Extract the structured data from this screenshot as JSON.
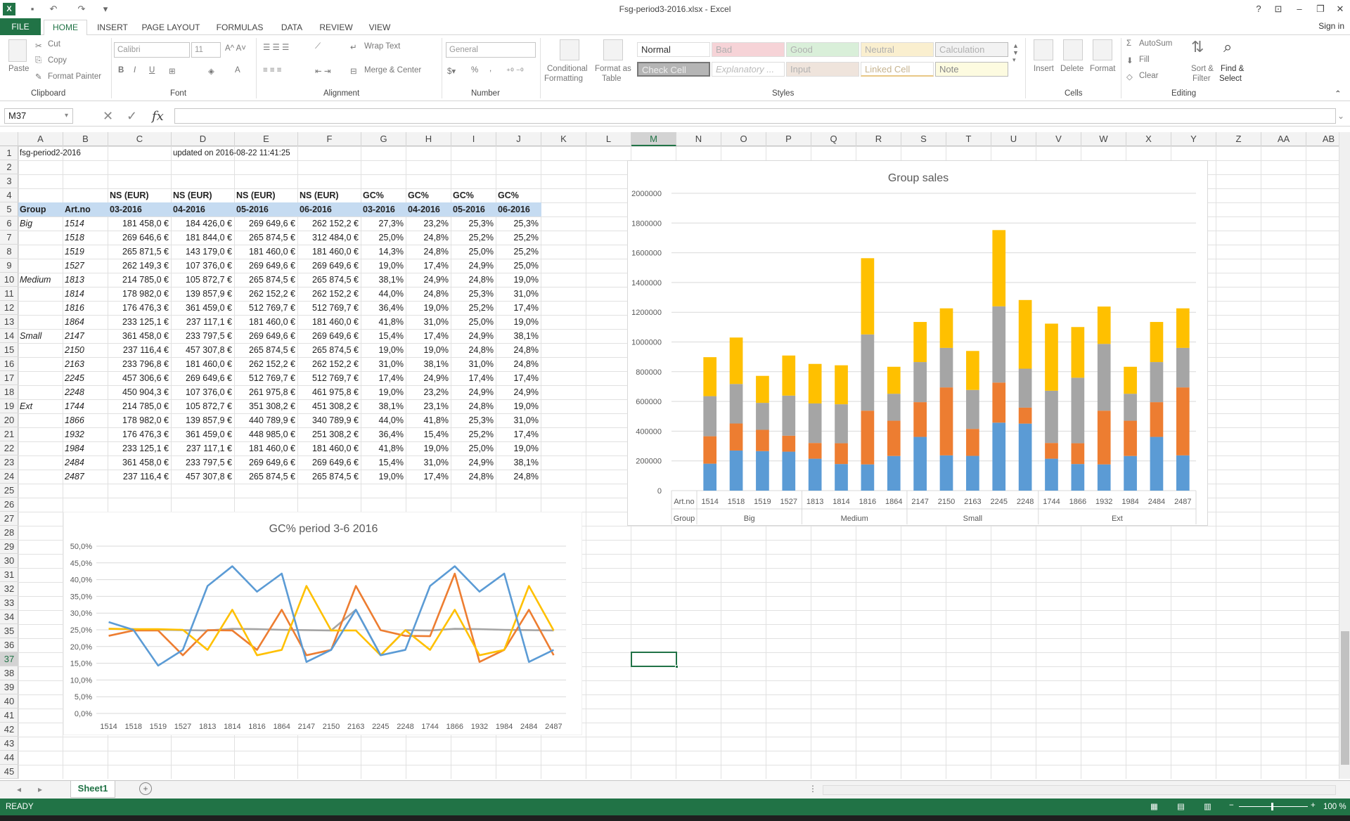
{
  "app": {
    "window_title": "Fsg-period3-2016.xlsx - Excel",
    "sign_in": "Sign in",
    "help": "?"
  },
  "tabs": [
    "FILE",
    "HOME",
    "INSERT",
    "PAGE LAYOUT",
    "FORMULAS",
    "DATA",
    "REVIEW",
    "VIEW"
  ],
  "ribbon": {
    "clipboard": {
      "label": "Clipboard",
      "paste": "Paste",
      "cut": "Cut",
      "copy": "Copy",
      "format_painter": "Format Painter"
    },
    "font": {
      "label": "Font",
      "family": "Calibri",
      "size": "11",
      "bold": "B",
      "italic": "I",
      "underline": "U"
    },
    "alignment": {
      "label": "Alignment",
      "wrap": "Wrap Text",
      "merge": "Merge & Center"
    },
    "number": {
      "label": "Number",
      "format": "General",
      "percent": "%",
      "comma": ","
    },
    "styles": {
      "label": "Styles",
      "conditional": "Conditional",
      "conditional2": "Formatting",
      "format_as": "Format as",
      "format_as2": "Table",
      "items": [
        "Normal",
        "Bad",
        "Good",
        "Neutral",
        "Calculation",
        "Check Cell",
        "Explanatory ...",
        "Input",
        "Linked Cell",
        "Note"
      ]
    },
    "cells": {
      "label": "Cells",
      "insert": "Insert",
      "delete": "Delete",
      "format": "Format"
    },
    "editing": {
      "label": "Editing",
      "autosum": "AutoSum",
      "fill": "Fill",
      "clear": "Clear",
      "sort": "Sort &",
      "sort2": "Filter",
      "find": "Find &",
      "find2": "Select"
    }
  },
  "formula_bar": {
    "name_box": "M37",
    "value": "",
    "fx": "fx"
  },
  "columns": [
    "A",
    "B",
    "C",
    "D",
    "E",
    "F",
    "G",
    "H",
    "I",
    "J",
    "K",
    "L",
    "M",
    "N",
    "O",
    "P",
    "Q",
    "R",
    "S",
    "T",
    "U",
    "V",
    "W",
    "X",
    "Y",
    "Z",
    "AA",
    "AB"
  ],
  "selected_column": "M",
  "selected_row": 37,
  "sheet": {
    "a1": "fsg-period2-2016",
    "d1": "updated on 2016-08-22 11:41:25",
    "row4": [
      "NS (EUR)",
      "NS (EUR)",
      "NS (EUR)",
      "NS (EUR)",
      "GC%",
      "GC%",
      "GC%",
      "GC%"
    ],
    "row5": [
      "Group",
      "Art.no",
      "03-2016",
      "04-2016",
      "05-2016",
      "06-2016",
      "03-2016",
      "04-2016",
      "05-2016",
      "06-2016"
    ],
    "rows": [
      [
        "Big",
        "1514",
        "181 458,0 €",
        "184 426,0 €",
        "269 649,6 €",
        "262 152,2 €",
        "27,3%",
        "23,2%",
        "25,3%",
        "25,3%"
      ],
      [
        "",
        "1518",
        "269 646,6 €",
        "181 844,0 €",
        "265 874,5 €",
        "312 484,0 €",
        "25,0%",
        "24,8%",
        "25,2%",
        "25,2%"
      ],
      [
        "",
        "1519",
        "265 871,5 €",
        "143 179,0 €",
        "181 460,0 €",
        "181 460,0 €",
        "14,3%",
        "24,8%",
        "25,0%",
        "25,2%"
      ],
      [
        "",
        "1527",
        "262 149,3 €",
        "107 376,0 €",
        "269 649,6 €",
        "269 649,6 €",
        "19,0%",
        "17,4%",
        "24,9%",
        "25,0%"
      ],
      [
        "Medium",
        "1813",
        "214 785,0 €",
        "105 872,7 €",
        "265 874,5 €",
        "265 874,5 €",
        "38,1%",
        "24,9%",
        "24,8%",
        "19,0%"
      ],
      [
        "",
        "1814",
        "178 982,0 €",
        "139 857,9 €",
        "262 152,2 €",
        "262 152,2 €",
        "44,0%",
        "24,8%",
        "25,3%",
        "31,0%"
      ],
      [
        "",
        "1816",
        "176 476,3 €",
        "361 459,0 €",
        "512 769,7 €",
        "512 769,7 €",
        "36,4%",
        "19,0%",
        "25,2%",
        "17,4%"
      ],
      [
        "",
        "1864",
        "233 125,1 €",
        "237 117,1 €",
        "181 460,0 €",
        "181 460,0 €",
        "41,8%",
        "31,0%",
        "25,0%",
        "19,0%"
      ],
      [
        "Small",
        "2147",
        "361 458,0 €",
        "233 797,5 €",
        "269 649,6 €",
        "269 649,6 €",
        "15,4%",
        "17,4%",
        "24,9%",
        "38,1%"
      ],
      [
        "",
        "2150",
        "237 116,4 €",
        "457 307,8 €",
        "265 874,5 €",
        "265 874,5 €",
        "19,0%",
        "19,0%",
        "24,8%",
        "24,8%"
      ],
      [
        "",
        "2163",
        "233 796,8 €",
        "181 460,0 €",
        "262 152,2 €",
        "262 152,2 €",
        "31,0%",
        "38,1%",
        "31,0%",
        "24,8%"
      ],
      [
        "",
        "2245",
        "457 306,6 €",
        "269 649,6 €",
        "512 769,7 €",
        "512 769,7 €",
        "17,4%",
        "24,9%",
        "17,4%",
        "17,4%"
      ],
      [
        "",
        "2248",
        "450 904,3 €",
        "107 376,0 €",
        "261 975,8 €",
        "461 975,8 €",
        "19,0%",
        "23,2%",
        "24,9%",
        "24,9%"
      ],
      [
        "Ext",
        "1744",
        "214 785,0 €",
        "105 872,7 €",
        "351 308,2 €",
        "451 308,2 €",
        "38,1%",
        "23,1%",
        "24,8%",
        "19,0%"
      ],
      [
        "",
        "1866",
        "178 982,0 €",
        "139 857,9 €",
        "440 789,9 €",
        "340 789,9 €",
        "44,0%",
        "41,8%",
        "25,3%",
        "31,0%"
      ],
      [
        "",
        "1932",
        "176 476,3 €",
        "361 459,0 €",
        "448 985,0 €",
        "251 308,2 €",
        "36,4%",
        "15,4%",
        "25,2%",
        "17,4%"
      ],
      [
        "",
        "1984",
        "233 125,1 €",
        "237 117,1 €",
        "181 460,0 €",
        "181 460,0 €",
        "41,8%",
        "19,0%",
        "25,0%",
        "19,0%"
      ],
      [
        "",
        "2484",
        "361 458,0 €",
        "233 797,5 €",
        "269 649,6 €",
        "269 649,6 €",
        "15,4%",
        "31,0%",
        "24,9%",
        "38,1%"
      ],
      [
        "",
        "2487",
        "237 116,4 €",
        "457 307,8 €",
        "265 874,5 €",
        "265 874,5 €",
        "19,0%",
        "17,4%",
        "24,8%",
        "24,8%"
      ]
    ]
  },
  "chart_data": [
    {
      "type": "bar",
      "stacked": true,
      "title": "Group sales",
      "ylim": [
        0,
        2000000
      ],
      "yticks": [
        0,
        200000,
        400000,
        600000,
        800000,
        1000000,
        1200000,
        1400000,
        1600000,
        1800000,
        2000000
      ],
      "x_header": "Art.no",
      "group_header": "Group",
      "categories": [
        "1514",
        "1518",
        "1519",
        "1527",
        "1813",
        "1814",
        "1816",
        "1864",
        "2147",
        "2150",
        "2163",
        "2245",
        "2248",
        "1744",
        "1866",
        "1932",
        "1984",
        "2484",
        "2487"
      ],
      "groups": [
        {
          "name": "Big",
          "count": 4
        },
        {
          "name": "Medium",
          "count": 4
        },
        {
          "name": "Small",
          "count": 5
        },
        {
          "name": "Ext",
          "count": 6
        }
      ],
      "colors": [
        "#5b9bd5",
        "#ed7d31",
        "#a5a5a5",
        "#ffc000"
      ],
      "series": [
        {
          "values": [
            181458,
            269647,
            265872,
            262149,
            214785,
            178982,
            176476,
            233125,
            361458,
            237116,
            233797,
            457307,
            450904,
            214785,
            178982,
            176476,
            233125,
            361458,
            237116
          ]
        },
        {
          "values": [
            184426,
            181844,
            143179,
            107376,
            105873,
            139858,
            361459,
            237117,
            233798,
            457308,
            181460,
            269650,
            107376,
            105873,
            139858,
            361459,
            237117,
            233798,
            457308
          ]
        },
        {
          "values": [
            269650,
            265875,
            181460,
            269650,
            265875,
            262152,
            512770,
            181460,
            269650,
            265875,
            262152,
            512770,
            261976,
            351308,
            440790,
            448985,
            181460,
            269650,
            265875
          ]
        },
        {
          "values": [
            262152,
            312484,
            181460,
            269650,
            265875,
            262152,
            512770,
            181460,
            269650,
            265875,
            262152,
            512770,
            461976,
            451308,
            340790,
            251308,
            181460,
            269650,
            265875
          ]
        }
      ]
    },
    {
      "type": "line",
      "title": "GC% period 3-6 2016",
      "ylim": [
        0,
        50
      ],
      "yticks": [
        "0,0%",
        "5,0%",
        "10,0%",
        "15,0%",
        "20,0%",
        "25,0%",
        "30,0%",
        "35,0%",
        "40,0%",
        "45,0%",
        "50,0%"
      ],
      "categories": [
        "1514",
        "1518",
        "1519",
        "1527",
        "1813",
        "1814",
        "1816",
        "1864",
        "2147",
        "2150",
        "2163",
        "2245",
        "2248",
        "1744",
        "1866",
        "1932",
        "1984",
        "2484",
        "2487"
      ],
      "colors": [
        "#5b9bd5",
        "#ed7d31",
        "#a5a5a5",
        "#ffc000"
      ],
      "series": [
        {
          "values": [
            27.3,
            25.0,
            14.3,
            19.0,
            38.1,
            44.0,
            36.4,
            41.8,
            15.4,
            19.0,
            31.0,
            17.4,
            19.0,
            38.1,
            44.0,
            36.4,
            41.8,
            15.4,
            19.0
          ]
        },
        {
          "values": [
            23.2,
            24.8,
            24.8,
            17.4,
            24.9,
            24.8,
            19.0,
            31.0,
            17.4,
            19.0,
            38.1,
            24.9,
            23.2,
            23.1,
            41.8,
            15.4,
            19.0,
            31.0,
            17.4
          ]
        },
        {
          "values": [
            25.3,
            25.2,
            25.0,
            24.9,
            24.8,
            25.3,
            25.2,
            25.0,
            24.9,
            24.8,
            31.0,
            17.4,
            24.9,
            24.8,
            25.3,
            25.2,
            25.0,
            24.9,
            24.8
          ]
        },
        {
          "values": [
            25.3,
            25.2,
            25.2,
            25.0,
            19.0,
            31.0,
            17.4,
            19.0,
            38.1,
            24.8,
            24.8,
            17.4,
            24.9,
            19.0,
            31.0,
            17.4,
            19.0,
            38.1,
            24.8
          ]
        }
      ]
    }
  ],
  "sheet_tab": "Sheet1",
  "status": {
    "ready": "READY",
    "zoom": "100 %"
  }
}
